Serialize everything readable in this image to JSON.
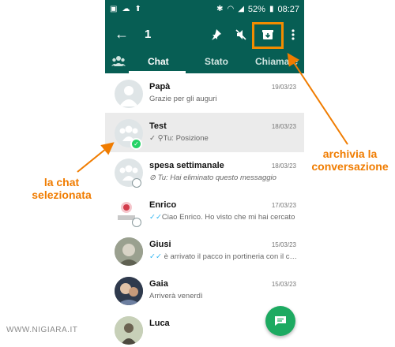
{
  "status_bar": {
    "battery": "52%",
    "time": "08:27"
  },
  "toolbar": {
    "selected_count": "1"
  },
  "tabs": [
    {
      "label": "Chat"
    },
    {
      "label": "Stato"
    },
    {
      "label": "Chiamate"
    }
  ],
  "chats": [
    {
      "name": "Papà",
      "date": "19/03/23",
      "message": "Grazie per gli auguri"
    },
    {
      "name": "Test",
      "date": "18/03/23",
      "message": "Tu: Posizione"
    },
    {
      "name": "spesa settimanale",
      "date": "18/03/23",
      "message": "Tu: Hai eliminato questo messaggio"
    },
    {
      "name": "Enrico",
      "date": "17/03/23",
      "message": "Ciao Enrico. Ho visto che mi hai cercato"
    },
    {
      "name": "Giusi",
      "date": "15/03/23",
      "message": "è arrivato il pacco in portineria con il corriere"
    },
    {
      "name": "Gaia",
      "date": "15/03/23",
      "message": "Arriverà venerdì"
    },
    {
      "name": "Luca",
      "date": "",
      "message": ""
    }
  ],
  "annotations": {
    "selected_chat": "la chat selezionata",
    "archive": "archivia la conversazione"
  },
  "watermark": "WWW.NIGIARA.IT",
  "colors": {
    "header": "#075e54",
    "accent": "#25d366",
    "annotation": "#f07c00",
    "read_ticks": "#34b7f1"
  }
}
